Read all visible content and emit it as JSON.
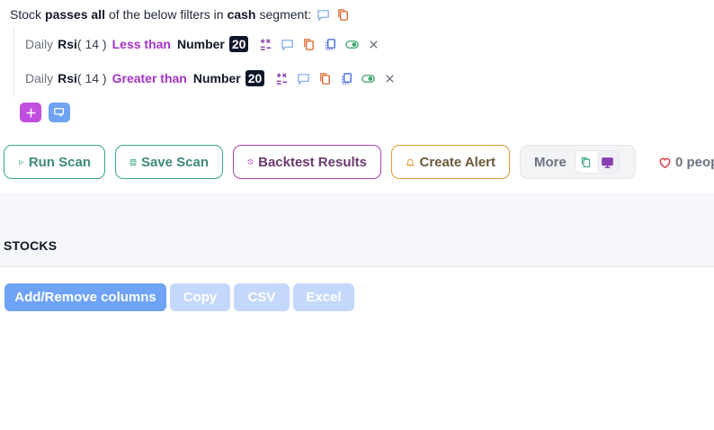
{
  "header": {
    "prefix": "Stock",
    "bold1": "passes all",
    "middle": "of the below filters in",
    "bold2": "cash",
    "suffix": "segment:"
  },
  "filters": [
    {
      "timeframe": "Daily",
      "indicator": "Rsi",
      "param": "( 14 )",
      "operator": "Less than",
      "compare_label": "Number",
      "value": "20"
    },
    {
      "timeframe": "Daily",
      "indicator": "Rsi",
      "param": "( 14 )",
      "operator": "Greater than",
      "compare_label": "Number",
      "value": "20"
    }
  ],
  "actions": {
    "run": "Run Scan",
    "save": "Save Scan",
    "backtest": "Backtest Results",
    "alert": "Create Alert",
    "more": "More",
    "likes": "0 peop"
  },
  "stocks": {
    "title": "STOCKS",
    "add_remove": "Add/Remove columns",
    "copy": "Copy",
    "csv": "CSV",
    "excel": "Excel"
  },
  "colors": {
    "operator": "#a633c8",
    "green": "#3aa589",
    "purple": "#b03fb7",
    "orange": "#e09a38",
    "primary_blue": "#6ea3f5"
  },
  "icons": [
    "comment-icon",
    "copy-icon",
    "arithmetic-icon",
    "duplicate-icon",
    "toggle-icon",
    "close-icon",
    "plus-icon",
    "group-icon",
    "play-icon",
    "save-icon",
    "history-icon",
    "bell-icon",
    "monitor-icon",
    "heart-icon"
  ]
}
